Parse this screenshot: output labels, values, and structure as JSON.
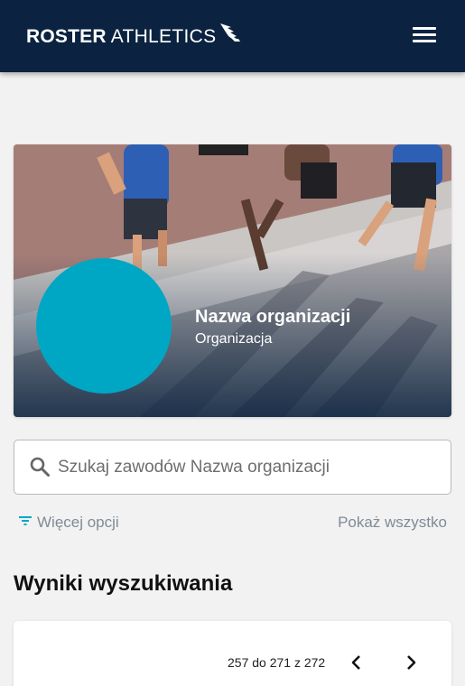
{
  "header": {
    "logo_bold": "ROSTER",
    "logo_light": "ATHLETICS",
    "menu_icon": "hamburger-menu-icon"
  },
  "organization": {
    "name": "Nazwa organizacji",
    "type": "Organizacja",
    "avatar_color": "#00a7c4"
  },
  "search": {
    "placeholder": "Szukaj zawodów Nazwa organizacji",
    "value": ""
  },
  "filters": {
    "more_options_label": "Więcej opcji",
    "show_all_label": "Pokaż wszystko"
  },
  "results": {
    "title": "Wyniki wyszukiwania",
    "pagination": "257 do 271 z 272"
  },
  "colors": {
    "topbar": "#0b2340",
    "accent": "#00a7c4",
    "muted_text": "#7f8b96"
  }
}
